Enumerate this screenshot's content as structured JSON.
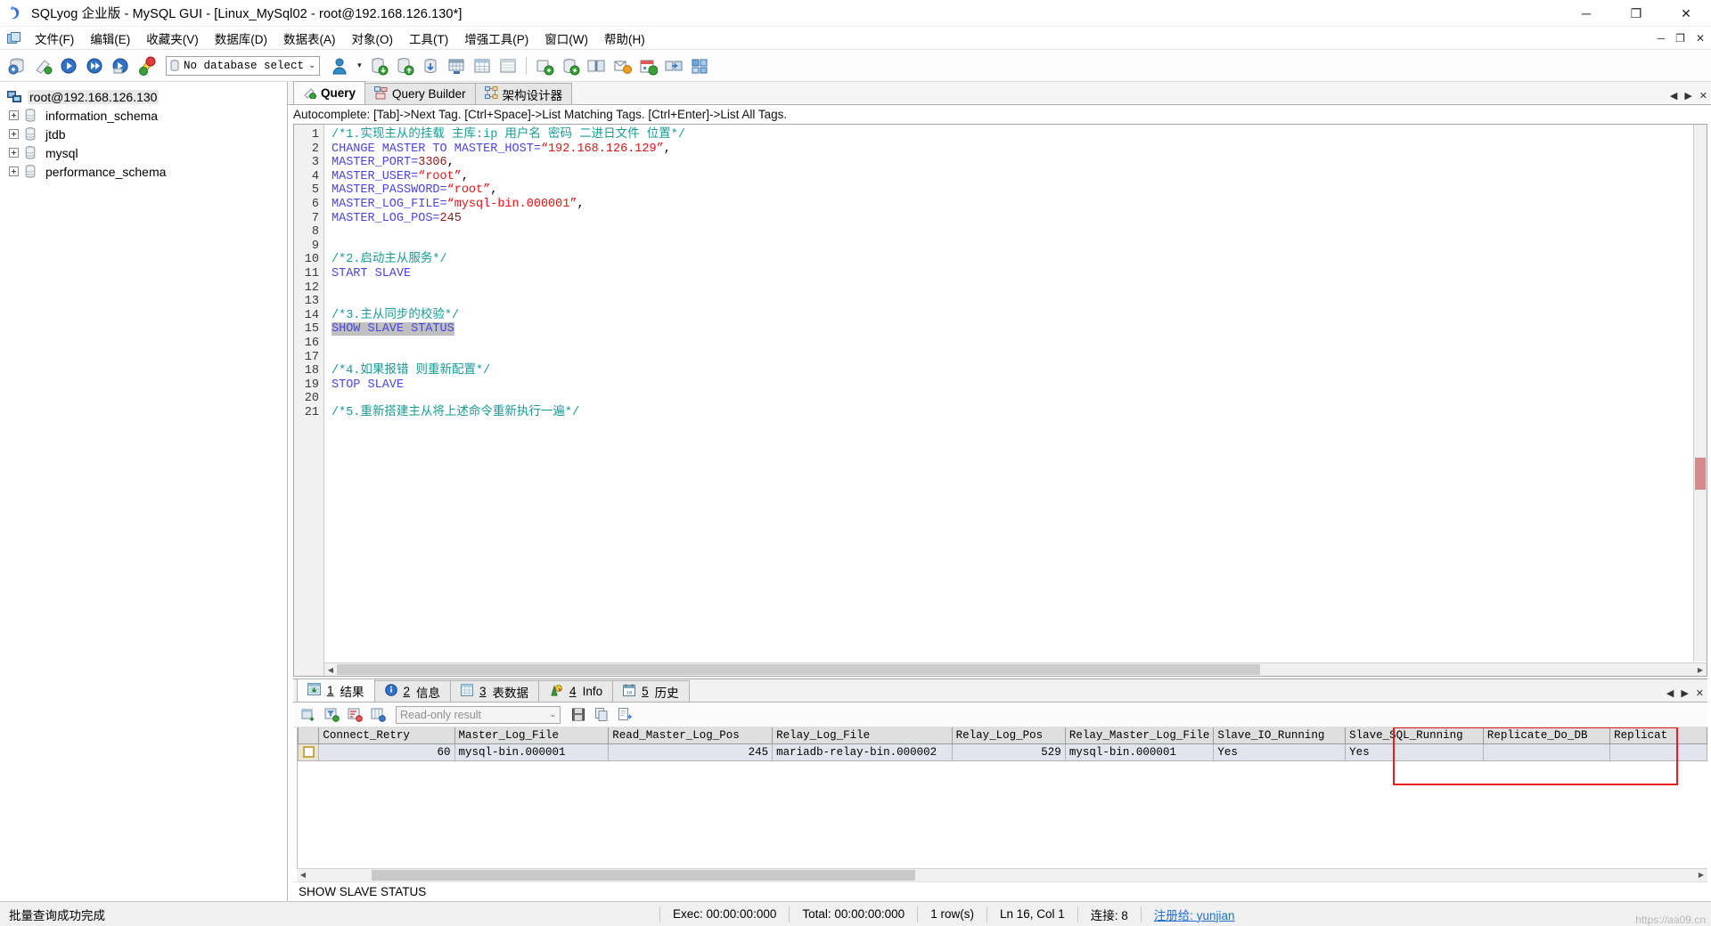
{
  "window": {
    "title": "SQLyog 企业版 - MySQL GUI - [Linux_MySql02 - root@192.168.126.130*]",
    "app_icon": "sqlyog-icon",
    "minimize_label": "─",
    "maximize_label": "❐",
    "close_label": "✕"
  },
  "menubar": {
    "items": [
      {
        "label": "文件(F)",
        "name": "menu-file"
      },
      {
        "label": "编辑(E)",
        "name": "menu-edit"
      },
      {
        "label": "收藏夹(V)",
        "name": "menu-favorites"
      },
      {
        "label": "数据库(D)",
        "name": "menu-database"
      },
      {
        "label": "数据表(A)",
        "name": "menu-table"
      },
      {
        "label": "对象(O)",
        "name": "menu-objects"
      },
      {
        "label": "工具(T)",
        "name": "menu-tools"
      },
      {
        "label": "增强工具(P)",
        "name": "menu-powertools"
      },
      {
        "label": "窗口(W)",
        "name": "menu-window"
      },
      {
        "label": "帮助(H)",
        "name": "menu-help"
      }
    ],
    "mdi_minimize": "─",
    "mdi_restore": "❐",
    "mdi_close": "✕"
  },
  "toolbar": {
    "db_select_value": "No database select",
    "db_select_chevron": "⌄",
    "dropdown_arrow": "▾",
    "buttons": [
      "new-connection-icon",
      "clear-icon",
      "execute-query-icon",
      "execute-all-icon",
      "execute-current-icon",
      "stop-query-icon",
      "user-manager-icon",
      "backup-icon",
      "restore-icon",
      "import-icon",
      "export-csv-icon",
      "table-data-icon",
      "table-info-icon",
      "sync-icon",
      "schema-sync-icon",
      "compare-icon",
      "notifications-icon",
      "scheduler-icon",
      "migration-icon",
      "tunnel-icon"
    ]
  },
  "sidebar": {
    "root": {
      "label": "root@192.168.126.130",
      "icon": "server-icon"
    },
    "items": [
      {
        "label": "information_schema",
        "icon": "database-icon"
      },
      {
        "label": "jtdb",
        "icon": "database-icon"
      },
      {
        "label": "mysql",
        "icon": "database-icon"
      },
      {
        "label": "performance_schema",
        "icon": "database-icon"
      }
    ]
  },
  "editor": {
    "tabs": [
      {
        "label": "Query",
        "icon": "query-icon",
        "active": true
      },
      {
        "label": "Query Builder",
        "icon": "query-builder-icon",
        "active": false
      },
      {
        "label": "架构设计器",
        "icon": "schema-designer-icon",
        "active": false
      }
    ],
    "autocomplete_hint": "Autocomplete: [Tab]->Next Tag. [Ctrl+Space]->List Matching Tags. [Ctrl+Enter]->List All Tags.",
    "line_numbers": [
      "1",
      "2",
      "3",
      "4",
      "5",
      "6",
      "7",
      "8",
      "9",
      "10",
      "11",
      "12",
      "13",
      "14",
      "15",
      "16",
      "17",
      "18",
      "19",
      "20",
      "21"
    ],
    "lines": [
      {
        "n": 1,
        "tokens": [
          {
            "t": "/*1.实现主从的挂载 主库:ip 用户名 密码 二进日文件 位置*/",
            "c": "cmt"
          }
        ]
      },
      {
        "n": 2,
        "tokens": [
          {
            "t": "CHANGE MASTER TO MASTER_HOST=",
            "c": "kw"
          },
          {
            "t": "“192.168.126.129”",
            "c": "str"
          },
          {
            "t": ",",
            "c": "plain"
          }
        ]
      },
      {
        "n": 3,
        "tokens": [
          {
            "t": "MASTER_PORT=",
            "c": "kw"
          },
          {
            "t": "3306",
            "c": "num"
          },
          {
            "t": ",",
            "c": "plain"
          }
        ]
      },
      {
        "n": 4,
        "tokens": [
          {
            "t": "MASTER_USER=",
            "c": "kw"
          },
          {
            "t": "“root”",
            "c": "str"
          },
          {
            "t": ",",
            "c": "plain"
          }
        ]
      },
      {
        "n": 5,
        "tokens": [
          {
            "t": "MASTER_PASSWORD=",
            "c": "kw"
          },
          {
            "t": "“root”",
            "c": "str"
          },
          {
            "t": ",",
            "c": "plain"
          }
        ]
      },
      {
        "n": 6,
        "tokens": [
          {
            "t": "MASTER_LOG_FILE=",
            "c": "kw"
          },
          {
            "t": "“mysql-bin.000001”",
            "c": "str"
          },
          {
            "t": ",",
            "c": "plain"
          }
        ]
      },
      {
        "n": 7,
        "tokens": [
          {
            "t": "MASTER_LOG_POS=",
            "c": "kw"
          },
          {
            "t": "245",
            "c": "num"
          }
        ]
      },
      {
        "n": 8,
        "tokens": []
      },
      {
        "n": 9,
        "tokens": []
      },
      {
        "n": 10,
        "tokens": [
          {
            "t": "/*2.启动主从服务*/",
            "c": "cmt"
          }
        ]
      },
      {
        "n": 11,
        "tokens": [
          {
            "t": "START SLAVE",
            "c": "kw"
          }
        ]
      },
      {
        "n": 12,
        "tokens": []
      },
      {
        "n": 13,
        "tokens": []
      },
      {
        "n": 14,
        "tokens": [
          {
            "t": "/*3.主从同步的校验*/",
            "c": "cmt"
          }
        ]
      },
      {
        "n": 15,
        "tokens": [
          {
            "t": "SHOW SLAVE STATUS",
            "c": "kw sel"
          }
        ]
      },
      {
        "n": 16,
        "tokens": []
      },
      {
        "n": 17,
        "tokens": []
      },
      {
        "n": 18,
        "tokens": [
          {
            "t": "/*4.如果报错 则重新配置*/",
            "c": "cmt"
          }
        ]
      },
      {
        "n": 19,
        "tokens": [
          {
            "t": "STOP SLAVE",
            "c": "kw"
          }
        ]
      },
      {
        "n": 20,
        "tokens": []
      },
      {
        "n": 21,
        "tokens": [
          {
            "t": "/*5.重新搭建主从将上述命令重新执行一遍*/",
            "c": "cmt"
          }
        ]
      }
    ]
  },
  "results": {
    "tabs": [
      {
        "num": "1",
        "label": "结果",
        "icon": "result-grid-icon",
        "active": true
      },
      {
        "num": "2",
        "label": "信息",
        "icon": "info-blue-icon",
        "active": false
      },
      {
        "num": "3",
        "label": "表数据",
        "icon": "table-data-icon",
        "active": false
      },
      {
        "num": "4",
        "label": "Info",
        "icon": "objects-info-icon",
        "active": false
      },
      {
        "num": "5",
        "label": "历史",
        "icon": "history-calendar-icon",
        "active": false
      }
    ],
    "readonly_select": "Read-only result",
    "readonly_chevron": "⌄",
    "toolbar_buttons": [
      "refresh-icon",
      "filter-icon",
      "sort-icon",
      "columns-icon",
      "save-icon",
      "copy-icon",
      "export-icon"
    ],
    "columns": [
      "Connect_Retry",
      "Master_Log_File",
      "Read_Master_Log_Pos",
      "Relay_Log_File",
      "Relay_Log_Pos",
      "Relay_Master_Log_File",
      "Slave_IO_Running",
      "Slave_SQL_Running",
      "Replicate_Do_DB",
      "Replicat"
    ],
    "rows": [
      {
        "cells": [
          {
            "v": "60",
            "align": "num"
          },
          {
            "v": "mysql-bin.000001",
            "align": "text"
          },
          {
            "v": "245",
            "align": "num"
          },
          {
            "v": "mariadb-relay-bin.000002",
            "align": "text"
          },
          {
            "v": "529",
            "align": "num"
          },
          {
            "v": "mysql-bin.000001",
            "align": "text"
          },
          {
            "v": "Yes",
            "align": "text"
          },
          {
            "v": "Yes",
            "align": "text"
          },
          {
            "v": "",
            "align": "text"
          },
          {
            "v": "",
            "align": "text"
          }
        ]
      }
    ],
    "highlight_color": "#e81f1f",
    "highlighted_columns": [
      "Slave_IO_Running",
      "Slave_SQL_Running"
    ],
    "query_echo": "SHOW SLAVE STATUS"
  },
  "statusbar": {
    "message": "批量查询成功完成",
    "exec": "Exec: 00:00:00:000",
    "total": "Total: 00:00:00:000",
    "rows": "1 row(s)",
    "cursor": "Ln 16, Col 1",
    "connections": "连接: 8",
    "link": "注册给: yunjian",
    "watermark": "https://aa09.cn"
  }
}
